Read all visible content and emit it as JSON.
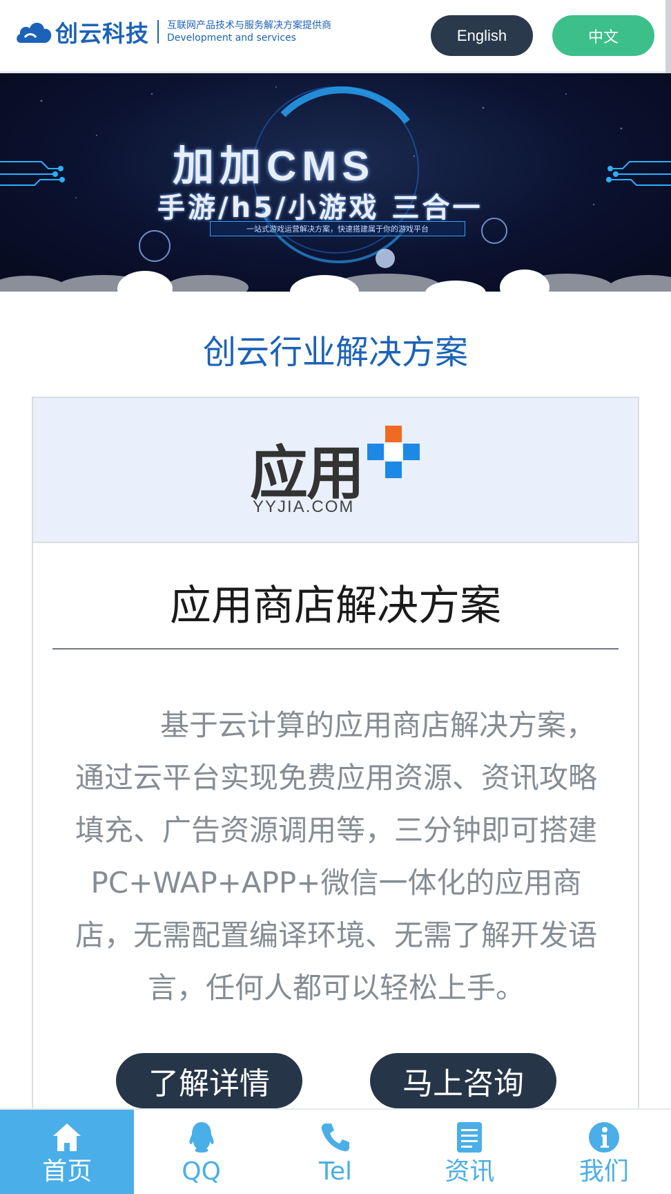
{
  "header": {
    "logo_name": "创云科技",
    "tagline_cn": "互联网产品技术与服务解决方案提供商",
    "tagline_en": "Development and services",
    "lang_english": "English",
    "lang_chinese": "中文"
  },
  "banner": {
    "title": "加加CMS",
    "subtitle": "手游/h5/小游戏 三合一",
    "caption": "一站式游戏运营解决方案，快速搭建属于你的游戏平台"
  },
  "section": {
    "title": "创云行业解决方案"
  },
  "card": {
    "logo_text": "应用",
    "logo_domain": "YYJIA.COM",
    "heading": "应用商店解决方案",
    "body": "基于云计算的应用商店解决方案，通过云平台实现免费应用资源、资讯攻略填充、广告资源调用等，三分钟即可搭建PC+WAP+APP+微信一体化的应用商店，无需配置编译环境、无需了解开发语言，任何人都可以轻松上手。",
    "btn_detail": "了解详情",
    "btn_consult": "马上咨询"
  },
  "bottom_nav": {
    "items": [
      {
        "label": "首页",
        "icon": "home-icon",
        "active": true
      },
      {
        "label": "QQ",
        "icon": "qq-icon",
        "active": false
      },
      {
        "label": "Tel",
        "icon": "phone-icon",
        "active": false
      },
      {
        "label": "资讯",
        "icon": "document-icon",
        "active": false
      },
      {
        "label": "我们",
        "icon": "info-icon",
        "active": false
      }
    ]
  },
  "colors": {
    "brand_blue": "#1c62b8",
    "dark_button": "#263648",
    "green_button": "#3dbf8a",
    "nav_blue": "#4aaee8"
  }
}
